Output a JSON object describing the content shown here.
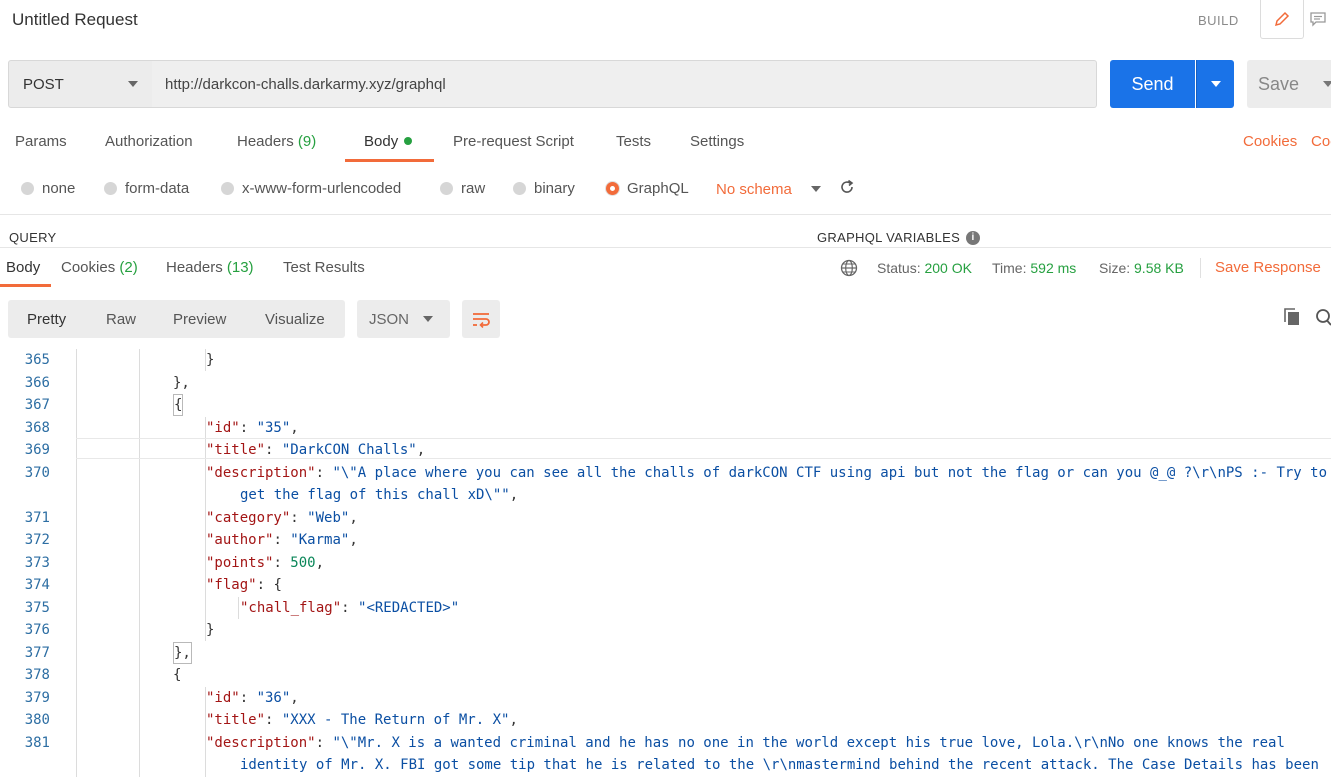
{
  "window": {
    "title": "Untitled Request",
    "mode_label": "BUILD"
  },
  "request": {
    "method": "POST",
    "url": "http://darkcon-challs.darkarmy.xyz/graphql",
    "send_label": "Send",
    "save_label": "Save"
  },
  "request_tabs": {
    "params": "Params",
    "authorization": "Authorization",
    "headers": "Headers",
    "headers_count": "(9)",
    "body": "Body",
    "prerequest": "Pre-request Script",
    "tests": "Tests",
    "settings": "Settings",
    "cookies": "Cookies",
    "code_partial": "Coo"
  },
  "body_types": {
    "none": "none",
    "form_data": "form-data",
    "urlencoded": "x-www-form-urlencoded",
    "raw": "raw",
    "binary": "binary",
    "graphql": "GraphQL",
    "selected": "GraphQL",
    "schema": "No schema"
  },
  "editor_labels": {
    "query": "QUERY",
    "variables": "GRAPHQL VARIABLES"
  },
  "response_tabs": {
    "body": "Body",
    "cookies": "Cookies",
    "cookies_count": "(2)",
    "headers": "Headers",
    "headers_count": "(13)",
    "test_results": "Test Results"
  },
  "response_status": {
    "status_label": "Status:",
    "status_value": "200 OK",
    "time_label": "Time:",
    "time_value": "592 ms",
    "size_label": "Size:",
    "size_value": "9.58 KB",
    "save_response": "Save Response"
  },
  "view_modes": {
    "pretty": "Pretty",
    "raw": "Raw",
    "preview": "Preview",
    "visualize": "Visualize",
    "format": "JSON"
  },
  "colors": {
    "accent": "#f26b3a",
    "send": "#1a73e8",
    "success": "#26a040"
  },
  "code": {
    "lines": [
      {
        "n": "365",
        "text": "}"
      },
      {
        "n": "366",
        "text": "},"
      },
      {
        "n": "367",
        "text": "{"
      },
      {
        "n": "368",
        "key": "\"id\"",
        "value": "\"35\"",
        "tail": ","
      },
      {
        "n": "369",
        "key": "\"title\"",
        "value": "\"DarkCON Challs\"",
        "tail": ","
      },
      {
        "n": "370",
        "key": "\"description\"",
        "value": "\"\\\"A place where you can see all the challs of darkCON CTF using api but not the flag or can you @_@ ?\\r\\nPS :- Try to",
        "cont": "get the flag of this chall xD\\\"\"",
        "tail": ","
      },
      {
        "n": "371",
        "key": "\"category\"",
        "value": "\"Web\"",
        "tail": ","
      },
      {
        "n": "372",
        "key": "\"author\"",
        "value": "\"Karma\"",
        "tail": ","
      },
      {
        "n": "373",
        "key": "\"points\"",
        "value": "500",
        "tail": ","
      },
      {
        "n": "374",
        "key": "\"flag\"",
        "value": "{",
        "tail": ""
      },
      {
        "n": "375",
        "key": "\"chall_flag\"",
        "value": "\"<REDACTED>\"",
        "tail": ""
      },
      {
        "n": "376",
        "text": "}"
      },
      {
        "n": "377",
        "text": "},"
      },
      {
        "n": "378",
        "text": "{"
      },
      {
        "n": "379",
        "key": "\"id\"",
        "value": "\"36\"",
        "tail": ","
      },
      {
        "n": "380",
        "key": "\"title\"",
        "value": "\"XXX - The Return of Mr. X\"",
        "tail": ","
      },
      {
        "n": "381",
        "key": "\"description\"",
        "value": "\"\\\"Mr. X is a wanted criminal and he has no one in the world except his true love, Lola.\\r\\nNo one knows the real",
        "cont": "identity of Mr. X. FBI got some tip that he is related to the \\r\\nmastermind behind the recent attack. The Case Details has been",
        "tail": ""
      }
    ]
  }
}
